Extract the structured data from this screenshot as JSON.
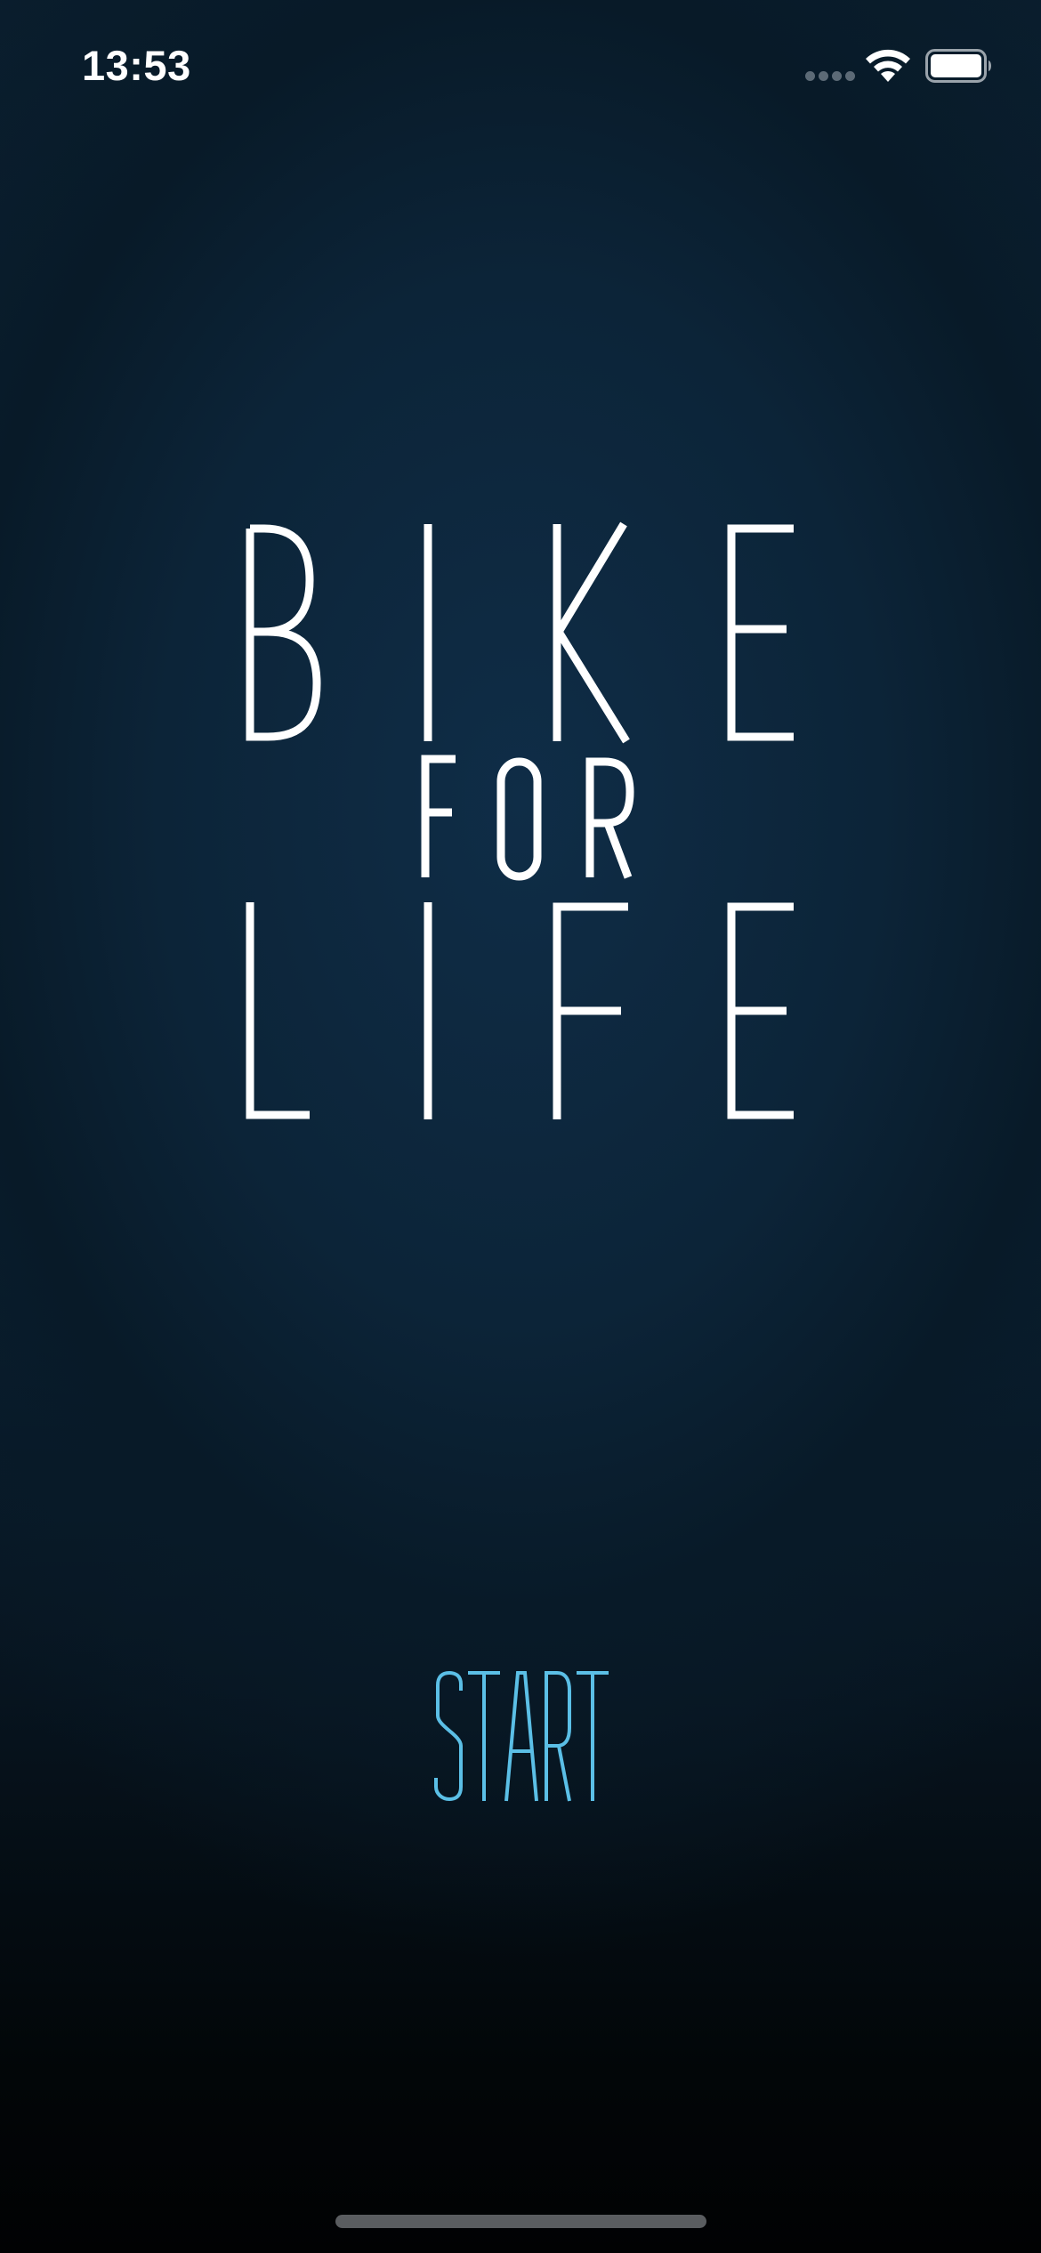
{
  "status_bar": {
    "time": "13:53",
    "signal_icon": "signal-dots-icon",
    "wifi_icon": "wifi-icon",
    "battery_icon": "battery-icon",
    "battery_level": 1.0
  },
  "logo": {
    "line1": "BIKE",
    "line2": "FOR",
    "line3": "LIFE",
    "color": "#ffffff"
  },
  "start": {
    "label": "START",
    "color": "#5bbfe6"
  },
  "colors": {
    "background_top": "#0a1e2e",
    "background_mid": "#0f2d47",
    "background_bottom": "#010203",
    "home_indicator": "#5a5d60"
  }
}
